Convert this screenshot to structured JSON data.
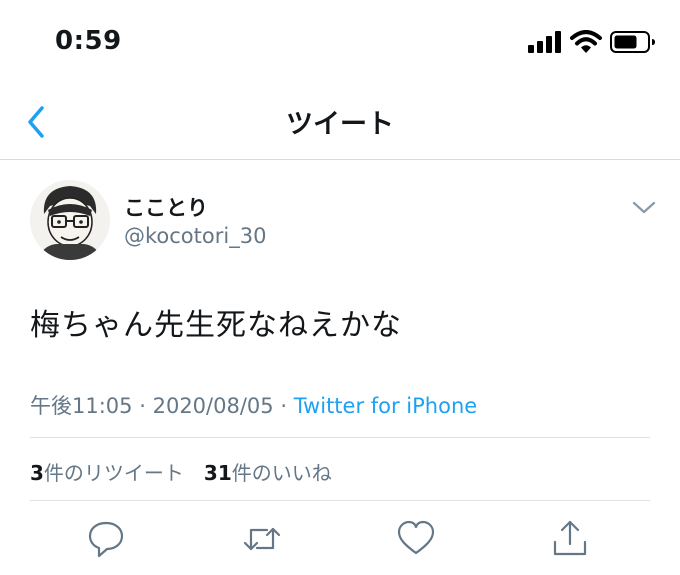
{
  "status_bar": {
    "time": "0:59",
    "icons": [
      "cellular-signal-icon",
      "wifi-icon",
      "battery-icon"
    ]
  },
  "nav": {
    "title": "ツイート",
    "back_icon": "chevron-left-icon"
  },
  "tweet": {
    "display_name": "こことり",
    "handle": "@kocotori_30",
    "text": "梅ちゃん先生死なねえかな",
    "time": "午後11:05",
    "separator": "·",
    "date": "2020/08/05",
    "source": "Twitter for iPhone"
  },
  "stats": {
    "retweets_count": "3",
    "retweets_label": "件のリツイート",
    "likes_count": "31",
    "likes_label": "件のいいね"
  },
  "actions": [
    "reply-icon",
    "retweet-icon",
    "like-icon",
    "share-icon"
  ],
  "colors": {
    "accent": "#1da1f2",
    "secondary_text": "#657786",
    "primary_text": "#14171a",
    "divider": "#dfe3e7"
  }
}
